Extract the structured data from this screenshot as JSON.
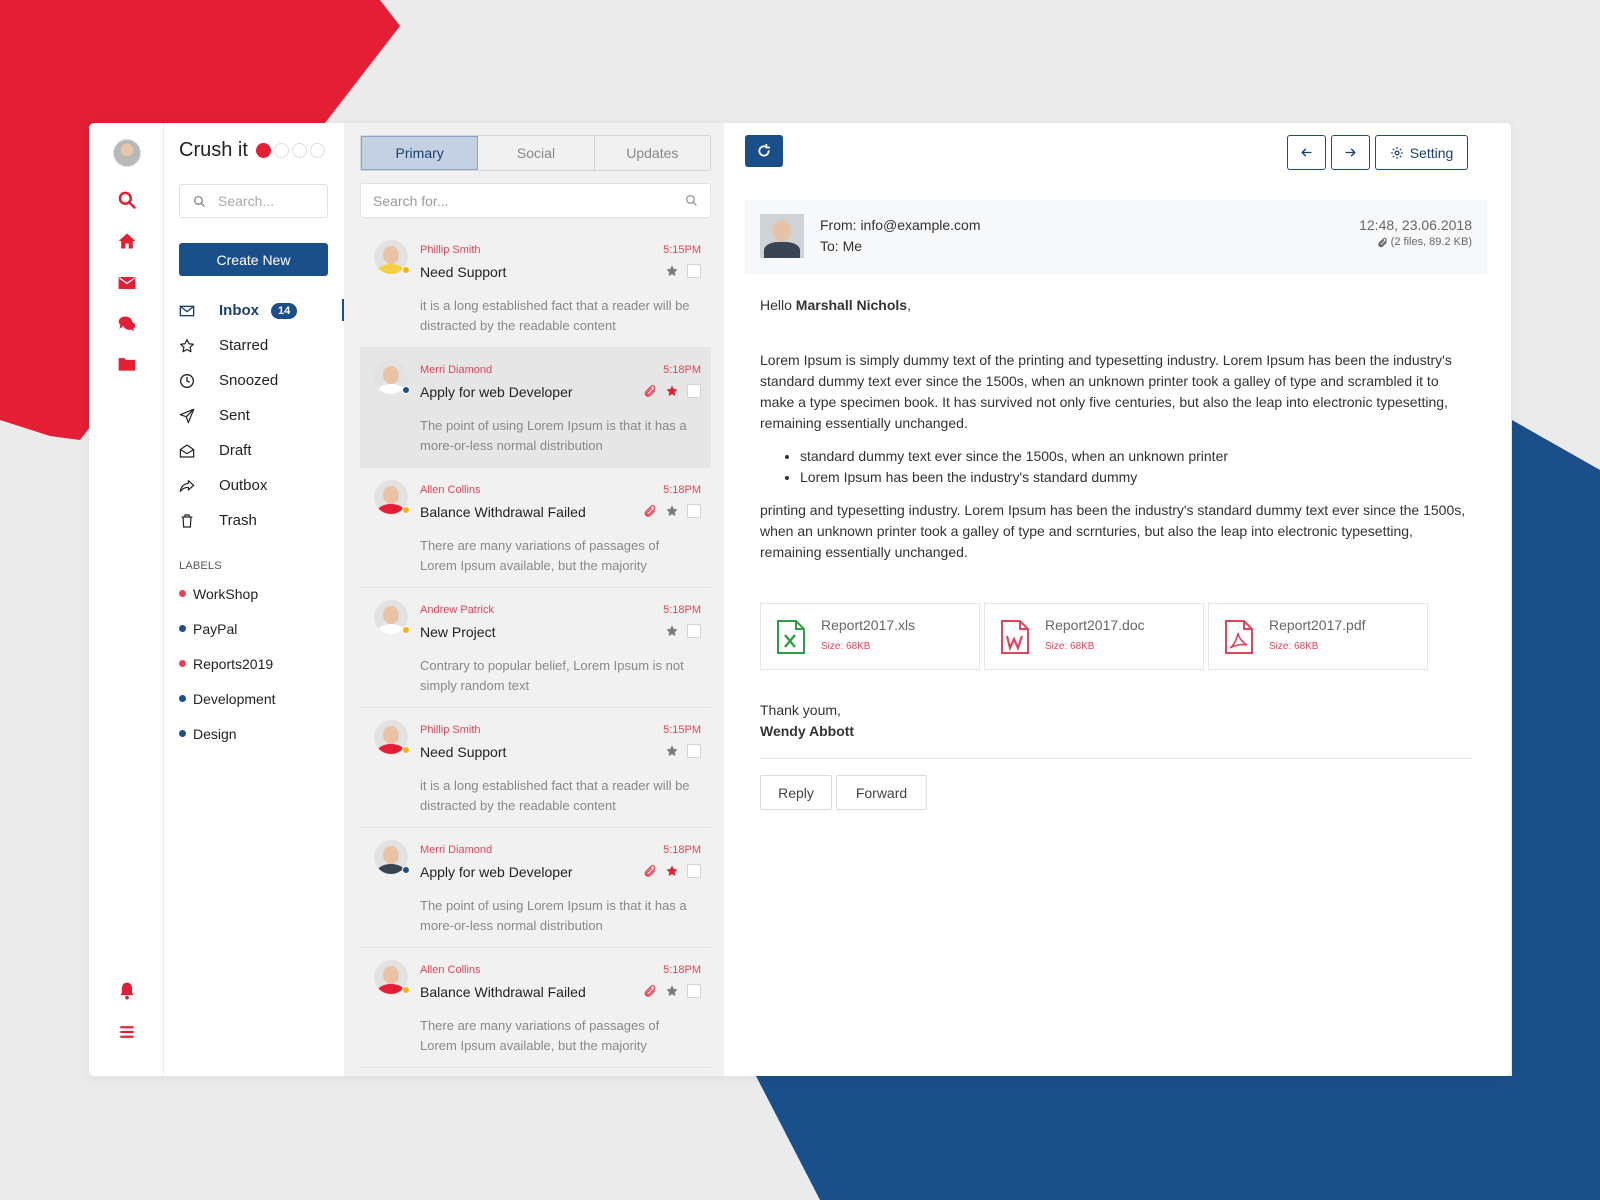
{
  "brand": {
    "name": "Crush it"
  },
  "colors": {
    "accent_red": "#e31e35",
    "accent_blue": "#1b4f8a",
    "sender_red": "#e8425a"
  },
  "rail": {
    "icons": [
      "search-icon",
      "home-icon",
      "envelope-icon",
      "chat-icon",
      "folder-icon",
      "bell-icon",
      "menu-icon"
    ]
  },
  "sidebar": {
    "search_placeholder": "Search...",
    "create_label": "Create New",
    "nav": [
      {
        "label": "Inbox",
        "icon": "envelope-icon",
        "badge": "14"
      },
      {
        "label": "Starred",
        "icon": "star-icon"
      },
      {
        "label": "Snoozed",
        "icon": "clock-icon"
      },
      {
        "label": "Sent",
        "icon": "send-icon"
      },
      {
        "label": "Draft",
        "icon": "envelope-open-icon"
      },
      {
        "label": "Outbox",
        "icon": "share-icon"
      },
      {
        "label": "Trash",
        "icon": "trash-icon"
      }
    ],
    "labels_title": "LABELS",
    "labels": [
      {
        "name": "WorkShop",
        "color": "#e8425a"
      },
      {
        "name": "PayPal",
        "color": "#1b4f8a"
      },
      {
        "name": "Reports2019",
        "color": "#e8425a"
      },
      {
        "name": "Development",
        "color": "#1b4f8a"
      },
      {
        "name": "Design",
        "color": "#1b4f8a"
      }
    ]
  },
  "list": {
    "tabs": [
      "Primary",
      "Social",
      "Updates"
    ],
    "search_placeholder": "Search for...",
    "messages": [
      {
        "sender": "Phillip Smith",
        "time": "5:15PM",
        "subject": "Need Support",
        "preview": "it is a long established fact that a reader will be distracted by the readable content",
        "attachment": false,
        "starred": false,
        "status_color": "#f5b400",
        "shirt": "#f4d03f"
      },
      {
        "sender": "Merri Diamond",
        "time": "5:18PM",
        "subject": "Apply for web Developer",
        "preview": "The point of using Lorem Ipsum is that it has a more-or-less normal distribution",
        "attachment": true,
        "starred": true,
        "status_color": "#1b4f8a",
        "shirt": "#ffffff"
      },
      {
        "sender": "Allen Collins",
        "time": "5:18PM",
        "subject": "Balance Withdrawal Failed",
        "preview": "There are many variations of passages of Lorem Ipsum available, but the majority",
        "attachment": true,
        "starred": false,
        "status_color": "#f5b400",
        "shirt": "#e31e35"
      },
      {
        "sender": "Andrew Patrick",
        "time": "5:18PM",
        "subject": "New Project",
        "preview": "Contrary to popular belief, Lorem Ipsum is not simply random text",
        "attachment": false,
        "starred": false,
        "status_color": "#f5b400",
        "shirt": "#ffffff"
      },
      {
        "sender": "Phillip Smith",
        "time": "5:15PM",
        "subject": "Need Support",
        "preview": "it is a long established fact that a reader will be distracted by the readable content",
        "attachment": false,
        "starred": false,
        "status_color": "#f5b400",
        "shirt": "#e31e35"
      },
      {
        "sender": "Merri Diamond",
        "time": "5:18PM",
        "subject": "Apply for web Developer",
        "preview": "The point of using Lorem Ipsum is that it has a more-or-less normal distribution",
        "attachment": true,
        "starred": true,
        "status_color": "#1b4f8a",
        "shirt": "#3a4453"
      },
      {
        "sender": "Allen Collins",
        "time": "5:18PM",
        "subject": "Balance Withdrawal Failed",
        "preview": "There are many variations of passages of Lorem Ipsum available, but the majority",
        "attachment": true,
        "starred": false,
        "status_color": "#f5b400",
        "shirt": "#e31e35"
      }
    ]
  },
  "reader": {
    "setting_label": "Setting",
    "from": "From: info@example.com",
    "to": "To: Me",
    "date": "12:48, 23.06.2018",
    "files": "(2 files, 89.2 KB)",
    "greeting_prefix": "Hello ",
    "greeting_name": "Marshall Nichols",
    "greeting_suffix": ",",
    "paragraph1": "Lorem Ipsum is simply dummy text of the printing and typesetting industry. Lorem Ipsum has been the industry's standard dummy text ever since the 1500s, when an unknown printer took a galley of type and scrambled it to make a type specimen book. It has survived not only five centuries, but also the leap into electronic typesetting, remaining essentially unchanged.",
    "bullets": [
      "standard dummy text ever since the 1500s, when an unknown printer",
      "Lorem Ipsum has been the industry's standard dummy"
    ],
    "paragraph2": "printing and typesetting industry. Lorem Ipsum has been the industry's standard dummy text ever since the 1500s, when an unknown printer took a galley of type and scrnturies, but also the leap into electronic typesetting, remaining essentially unchanged.",
    "attachments": [
      {
        "name": "Report2017.xls",
        "size": "Size: 68KB",
        "icon": "excel-file-icon",
        "color": "#2e9e44"
      },
      {
        "name": "Report2017.doc",
        "size": "Size: 68KB",
        "icon": "word-file-icon",
        "color": "#e8425a"
      },
      {
        "name": "Report2017.pdf",
        "size": "Size: 68KB",
        "icon": "pdf-file-icon",
        "color": "#e8425a"
      }
    ],
    "thanks": "Thank youm,",
    "signature": "Wendy Abbott",
    "reply_label": "Reply",
    "forward_label": "Forward"
  }
}
